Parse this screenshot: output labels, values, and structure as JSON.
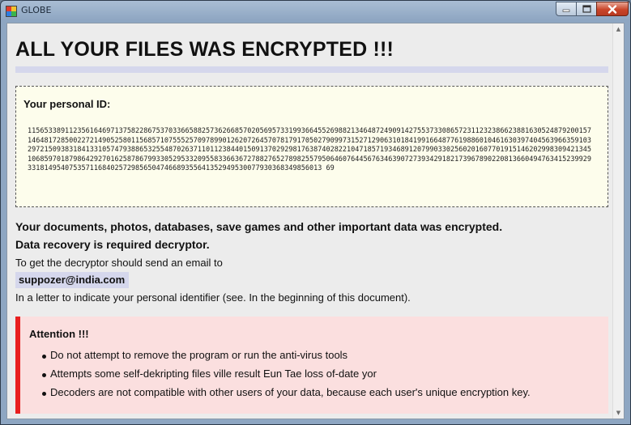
{
  "window": {
    "title": "GLOBE",
    "icon": "globe-shield-icon",
    "controls": [
      "minimize",
      "maximize",
      "close"
    ]
  },
  "document": {
    "headline": "ALL YOUR FILES WAS ENCRYPTED !!!",
    "id_label": "Your personal ID:",
    "personal_id": "115653389112356164697137582286753703366588257362668570205695733199366455269882134648724909142755373308657231123238662388163052487920015714648172850022721490525801156857107555257097899012620726457078179170502790997315271290631018419916648776198860104616303974045639663591032972150938318413310574793886532554870263711011238440150913702929817638740282210471857193468912079903302560201607701915146202998309421345106859701879864292701625878679933052953320955833663672788276527898255795064607644567634639072739342918217396789022081366049476341523992933181495407535711684025729856504746689355641352949530077930368349856013 69",
    "line1": "Your documents, photos, databases, save games and other important data was encrypted.",
    "line2": "Data recovery is required decryptor.",
    "line3": "To get the decryptor should send an email to",
    "email": "suppozer@india.com",
    "line4": "In a letter to indicate your personal identifier (see. In the beginning of this document).",
    "attention": {
      "title": "Attention !!!",
      "items": [
        "Do not attempt to remove the program or run the anti-virus tools",
        "Attempts some self-dekripting files ville result Eun Tae loss of-date yor",
        "Decoders are not compatible with other users of your data, because each user's unique encryption key."
      ]
    }
  },
  "colors": {
    "highlight": "#d5d7ec",
    "id_box_bg": "#fdfdec",
    "attention_bg": "#fbdfdf",
    "attention_bar": "#e81f1f",
    "close_button": "#c9452a"
  }
}
